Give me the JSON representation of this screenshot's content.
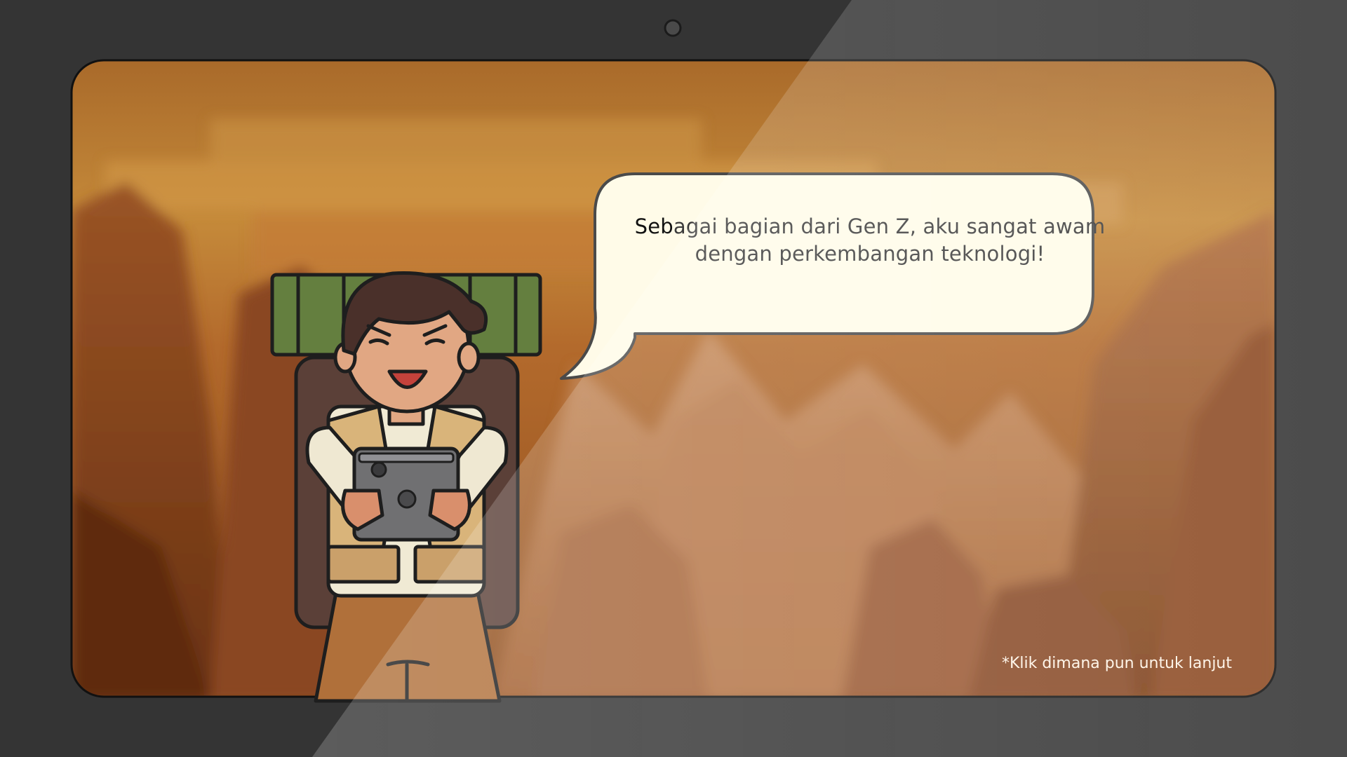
{
  "dialogue": {
    "lead": "Seb",
    "rest": "agai bagian dari Gen Z, aku sangat awam dengan perkembangan teknologi!"
  },
  "hint": {
    "continue": "*Klik dimana pun untuk lanjut"
  },
  "colors": {
    "bezel": "#343434",
    "sky_top": "#b8742c",
    "sky_bottom": "#8a4a1c",
    "bubble_fill": "#fffbe8",
    "outline": "#1e1e1e",
    "backpack_roll": "#5f7b3e",
    "vest": "#d8b57a",
    "skin": "#e1a783",
    "hair": "#4a302a",
    "tablet": "#6d6d6f"
  },
  "icons": {
    "camera": "webcam-dot",
    "logo_on_tablet": "apple-logo-icon"
  }
}
